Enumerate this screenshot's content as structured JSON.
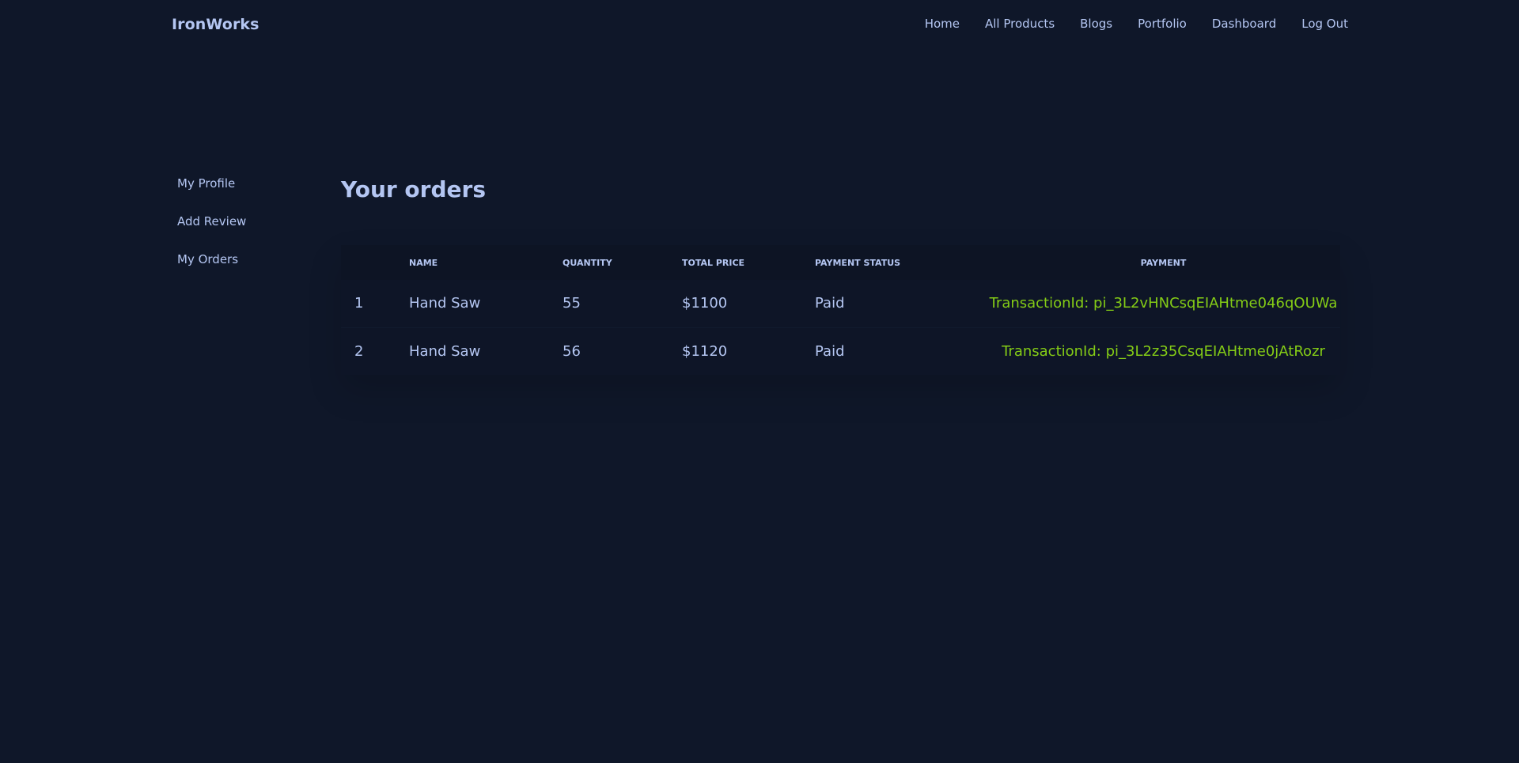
{
  "brand": "IronWorks",
  "nav": {
    "links": [
      "Home",
      "All Products",
      "Blogs",
      "Portfolio",
      "Dashboard",
      "Log Out"
    ]
  },
  "sidebar": {
    "items": [
      "My Profile",
      "Add Review",
      "My Orders"
    ]
  },
  "main": {
    "title": "Your orders",
    "table": {
      "headers": [
        "",
        "Name",
        "Quantity",
        "Total Price",
        "Payment Status",
        "Payment"
      ],
      "rows": [
        {
          "index": "1",
          "name": "Hand Saw",
          "quantity": "55",
          "total_price": "$1100",
          "status": "Paid",
          "payment": "TransactionId: pi_3L2vHNCsqEIAHtme046qOUWa"
        },
        {
          "index": "2",
          "name": "Hand Saw",
          "quantity": "56",
          "total_price": "$1120",
          "status": "Paid",
          "payment": "TransactionId: pi_3L2z35CsqEIAHtme0jAtRozr"
        }
      ]
    }
  },
  "colors": {
    "background": "#0f1729",
    "text": "#b4c6f2",
    "transaction": "#84cc16"
  }
}
